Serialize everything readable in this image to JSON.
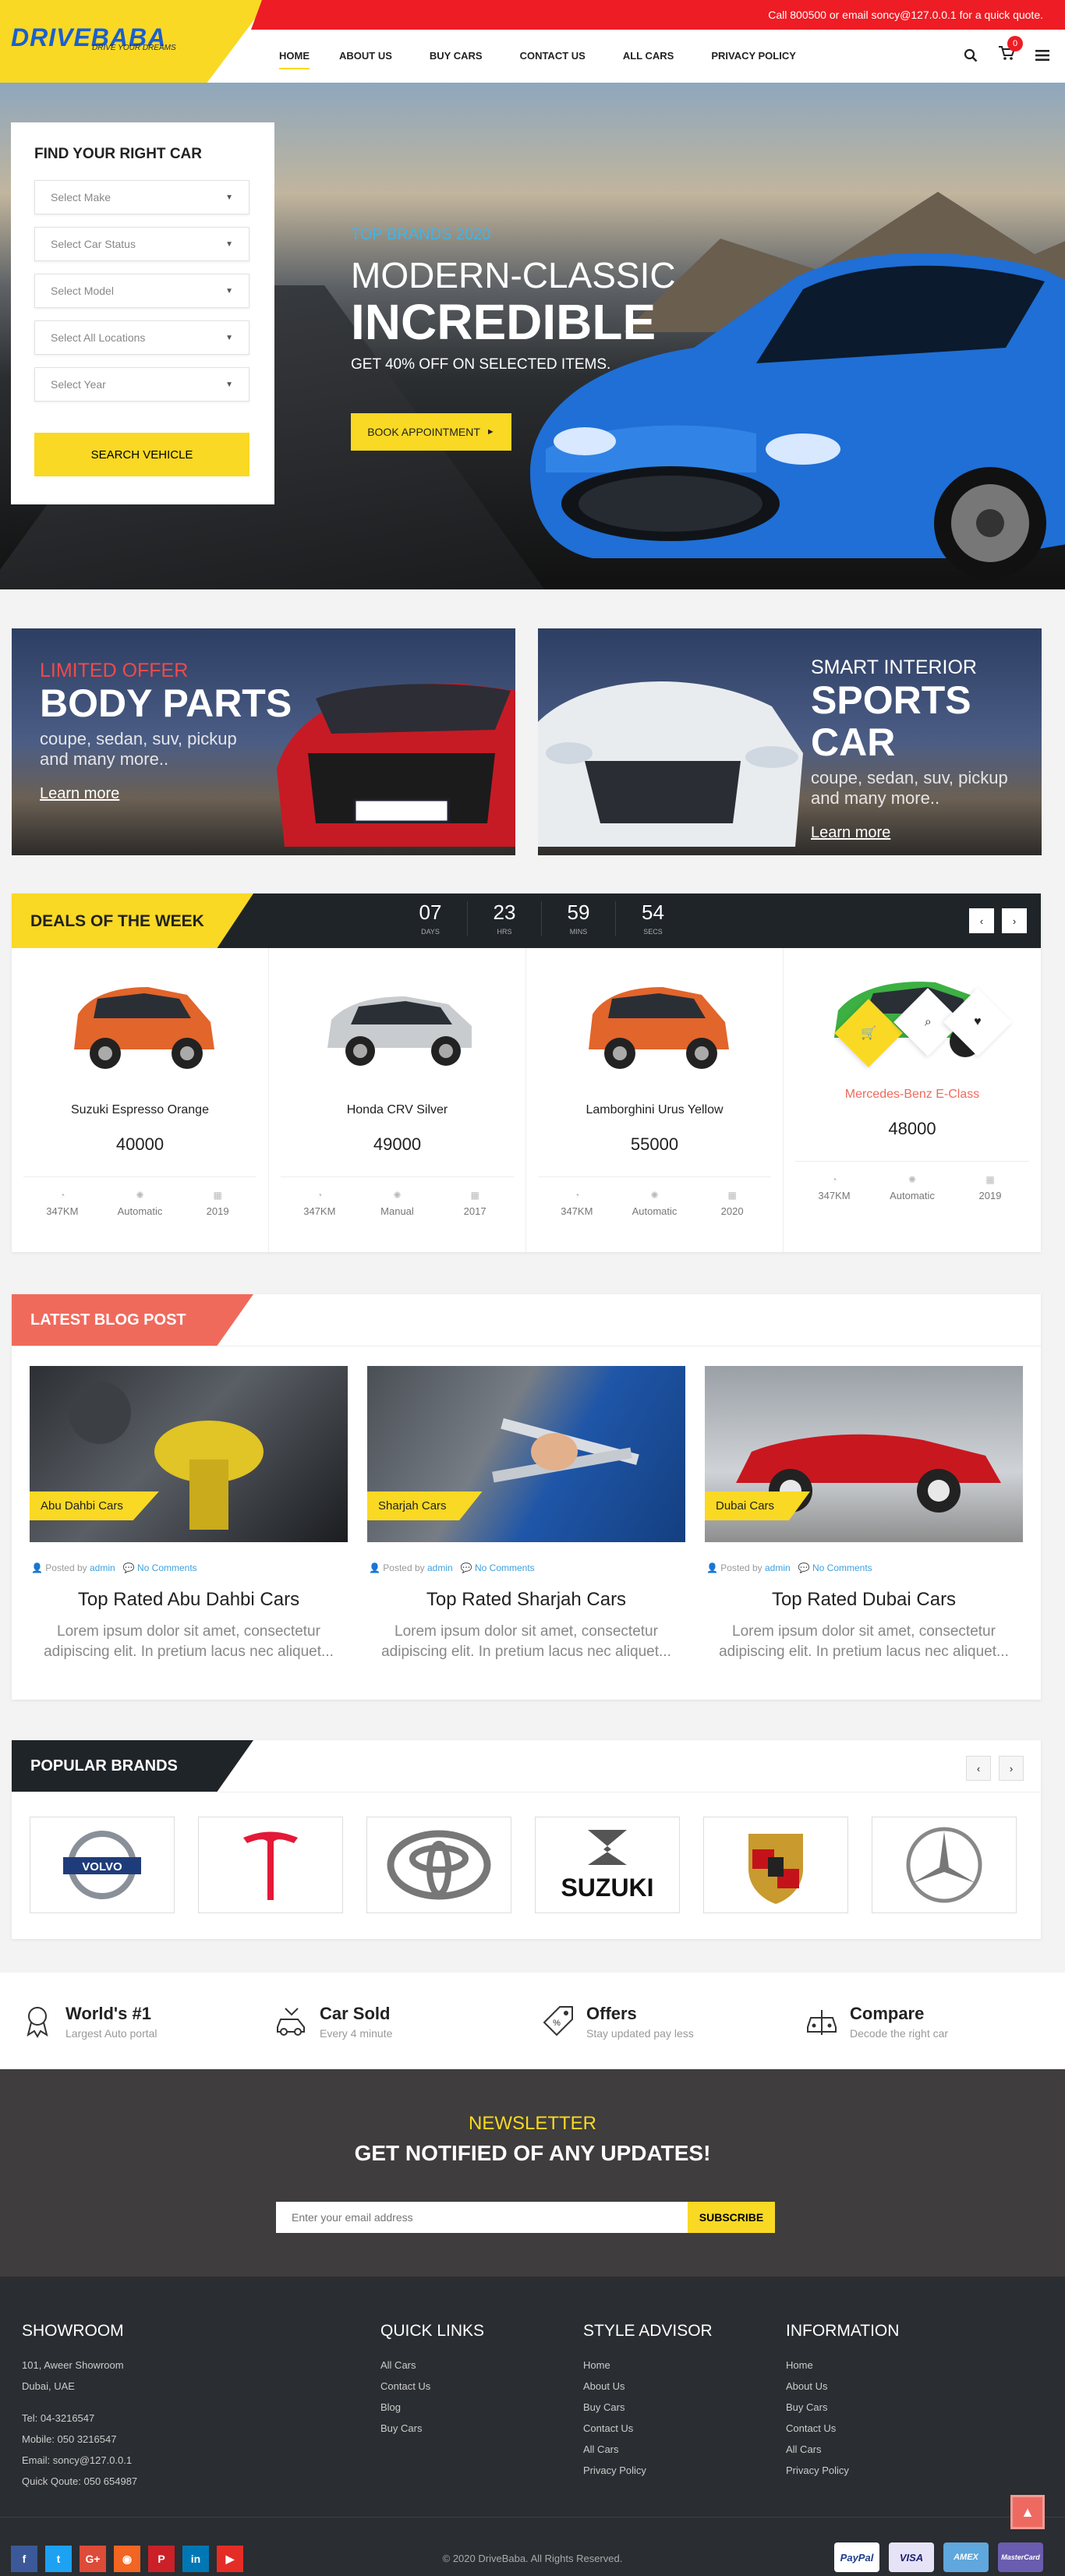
{
  "header": {
    "logo": "DRIVEBABA",
    "tagline": "DRIVE YOUR DREAMS",
    "topbar_text": "Call 800500 or email soncy@127.0.0.1 for a quick quote.",
    "nav": [
      "HOME",
      "ABOUT US",
      "BUY CARS",
      "CONTACT US",
      "ALL CARS",
      "PRIVACY POLICY"
    ],
    "cart_count": "0"
  },
  "search": {
    "title": "FIND YOUR RIGHT CAR",
    "fields": [
      "Select Make",
      "Select Car Status",
      "Select Model",
      "Select All Locations",
      "Select Year"
    ],
    "button": "SEARCH VEHICLE"
  },
  "hero": {
    "kicker": "TOP BRANDS 2020",
    "title_line1": "MODERN-CLASSIC",
    "title_line2": "INCREDIBLE",
    "subtitle": "GET 40% OFF ON SELECTED ITEMS.",
    "button": "BOOK APPOINTMENT"
  },
  "promos": [
    {
      "kicker": "LIMITED OFFER",
      "title": "BODY PARTS",
      "desc": "coupe, sedan, suv, pickup and many more..",
      "link": "Learn more"
    },
    {
      "kicker": "SMART INTERIOR",
      "title": "SPORTS CAR",
      "desc": "coupe, sedan, suv, pickup and many more..",
      "link": "Learn more"
    }
  ],
  "deals": {
    "title": "DEALS OF THE WEEK",
    "countdown": [
      {
        "value": "07",
        "label": "DAYS"
      },
      {
        "value": "23",
        "label": "HRS"
      },
      {
        "value": "59",
        "label": "MINS"
      },
      {
        "value": "54",
        "label": "SECS"
      }
    ],
    "items": [
      {
        "name": "Suzuki Espresso Orange",
        "price": "40000",
        "km": "347KM",
        "trans": "Automatic",
        "year": "2019",
        "color": "#e2652b"
      },
      {
        "name": "Honda CRV Silver",
        "price": "49000",
        "km": "347KM",
        "trans": "Manual",
        "year": "2017",
        "color": "#c9cccf"
      },
      {
        "name": "Lamborghini Urus Yellow",
        "price": "55000",
        "km": "347KM",
        "trans": "Automatic",
        "year": "2020",
        "color": "#e2652b"
      },
      {
        "name": "Mercedes-Benz E-Class",
        "price": "48000",
        "km": "347KM",
        "trans": "Automatic",
        "year": "2019",
        "color": "#3cb043"
      }
    ]
  },
  "blog": {
    "title": "LATEST BLOG POST",
    "posts": [
      {
        "tag": "Abu Dahbi Cars",
        "posted_by": "Posted by",
        "author": "admin",
        "comments": "No Comments",
        "title": "Top Rated Abu Dahbi Cars",
        "excerpt": "Lorem ipsum dolor sit amet, consectetur adipiscing elit. In pretium lacus nec aliquet..."
      },
      {
        "tag": "Sharjah Cars",
        "posted_by": "Posted by",
        "author": "admin",
        "comments": "No Comments",
        "title": "Top Rated Sharjah Cars",
        "excerpt": "Lorem ipsum dolor sit amet, consectetur adipiscing elit. In pretium lacus nec aliquet..."
      },
      {
        "tag": "Dubai Cars",
        "posted_by": "Posted by",
        "author": "admin",
        "comments": "No Comments",
        "title": "Top Rated Dubai Cars",
        "excerpt": "Lorem ipsum dolor sit amet, consectetur adipiscing elit. In pretium lacus nec aliquet..."
      }
    ]
  },
  "brands": {
    "title": "POPULAR BRANDS",
    "items": [
      "VOLVO",
      "TESLA",
      "TOYOTA",
      "SUZUKI",
      "PORSCHE",
      "MERCEDES"
    ]
  },
  "features": [
    {
      "title": "World's #1",
      "sub": "Largest Auto portal"
    },
    {
      "title": "Car Sold",
      "sub": "Every 4 minute"
    },
    {
      "title": "Offers",
      "sub": "Stay updated pay less"
    },
    {
      "title": "Compare",
      "sub": "Decode the right car"
    }
  ],
  "newsletter": {
    "kicker": "NEWSLETTER",
    "title": "GET NOTIFIED OF ANY UPDATES!",
    "placeholder": "Enter your email address",
    "button": "SUBSCRIBE"
  },
  "footer": {
    "showroom": {
      "title": "SHOWROOM",
      "address1": "101, Aweer Showroom",
      "address2": "Dubai, UAE",
      "tel": "Tel: 04-3216547",
      "mobile": "Mobile: 050 3216547",
      "email": "Email: soncy@127.0.0.1",
      "quote": "Quick Qoute: 050 654987"
    },
    "quick_links": {
      "title": "QUICK LINKS",
      "items": [
        "All Cars",
        "Contact Us",
        "Blog",
        "Buy Cars"
      ]
    },
    "style_advisor": {
      "title": "STYLE ADVISOR",
      "items": [
        "Home",
        "About Us",
        "Buy Cars",
        "Contact Us",
        "All Cars",
        "Privacy Policy"
      ]
    },
    "information": {
      "title": "INFORMATION",
      "items": [
        "Home",
        "About Us",
        "Buy Cars",
        "Contact Us",
        "All Cars",
        "Privacy Policy"
      ]
    },
    "copyright": "© 2020 DriveBaba. All Rights Reserved.",
    "socials": [
      {
        "icon": "facebook-icon",
        "glyph": "f",
        "color": "#3b5998"
      },
      {
        "icon": "twitter-icon",
        "glyph": "t",
        "color": "#1da1f2"
      },
      {
        "icon": "google-plus-icon",
        "glyph": "G+",
        "color": "#dd4b39"
      },
      {
        "icon": "rss-icon",
        "glyph": "◉",
        "color": "#f26522"
      },
      {
        "icon": "pinterest-icon",
        "glyph": "P",
        "color": "#cb2027"
      },
      {
        "icon": "linkedin-icon",
        "glyph": "in",
        "color": "#0077b5"
      },
      {
        "icon": "youtube-icon",
        "glyph": "▶",
        "color": "#e52d27"
      }
    ],
    "payments": [
      {
        "name": "PayPal",
        "bg": "#ffffff",
        "fg": "#1f3d8a"
      },
      {
        "name": "VISA",
        "bg": "#e7e3f6",
        "fg": "#1a1f71"
      },
      {
        "name": "AMEX",
        "bg": "#5fa7dd",
        "fg": "#ffffff"
      },
      {
        "name": "MasterCard",
        "bg": "#6a5cae",
        "fg": "#ffffff"
      }
    ]
  },
  "colors": {
    "accent": "#f9d923",
    "red": "#ee1c24",
    "coral": "#f06a5c",
    "dark": "#1f2428"
  }
}
